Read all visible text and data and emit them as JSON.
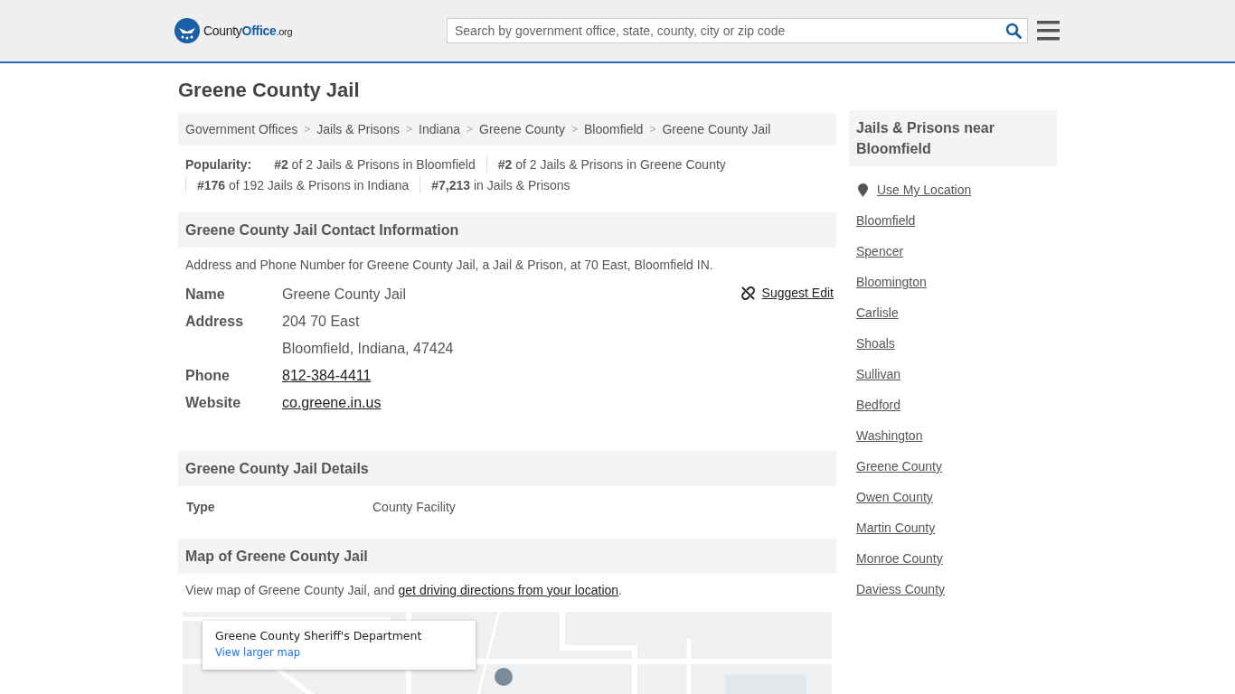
{
  "header": {
    "logo": [
      "County",
      "Office",
      ".org"
    ],
    "search": {
      "placeholder": "Search by government office, state, county, city or zip code"
    }
  },
  "title": "Greene County Jail",
  "breadcrumb": {
    "separator": ">",
    "items": [
      "Government Offices",
      "Jails & Prisons",
      "Indiana",
      "Greene County",
      "Bloomfield",
      "Greene County Jail"
    ]
  },
  "popularity": {
    "label": "Popularity:",
    "items": [
      "**#2** of 2 Jails & Prisons in Bloomfield",
      "**#2** of 2 Jails & Prisons in Greene County",
      "**#176** of 192 Jails & Prisons in Indiana",
      "**#7,213** in Jails & Prisons"
    ]
  },
  "contact": {
    "heading": "Greene County Jail Contact Information",
    "description": "Address and Phone Number for Greene County Jail, a Jail & Prison, at 70 East, Bloomfield IN.",
    "suggest_edit": "Suggest Edit",
    "rows": [
      {
        "label": "Name",
        "values": [
          "Greene County Jail"
        ],
        "kind": "text"
      },
      {
        "label": "Address",
        "values": [
          "204 70 East",
          "Bloomfield, Indiana, 47424"
        ],
        "kind": "text"
      },
      {
        "label": "Phone",
        "values": [
          "812-384-4411"
        ],
        "kind": "link"
      },
      {
        "label": "Website",
        "values": [
          "co.greene.in.us"
        ],
        "kind": "link"
      }
    ]
  },
  "details": {
    "heading": "Greene County Jail Details",
    "rows": [
      {
        "label": "Type",
        "value": "County Facility"
      }
    ]
  },
  "map": {
    "heading": "Map of Greene County Jail",
    "text_before": "View map of Greene County Jail, and ",
    "link": "get driving directions from your location",
    "text_after": ".",
    "card": {
      "title": "Greene County Sheriff's Department",
      "link": "View larger map"
    }
  },
  "sidebar": {
    "heading": "Jails & Prisons near Bloomfield",
    "use_location": "Use My Location",
    "links": [
      "Bloomfield",
      "Spencer",
      "Bloomington",
      "Carlisle",
      "Shoals",
      "Sullivan",
      "Bedford",
      "Washington",
      "Greene County",
      "Owen County",
      "Martin County",
      "Monroe County",
      "Daviess County"
    ]
  }
}
